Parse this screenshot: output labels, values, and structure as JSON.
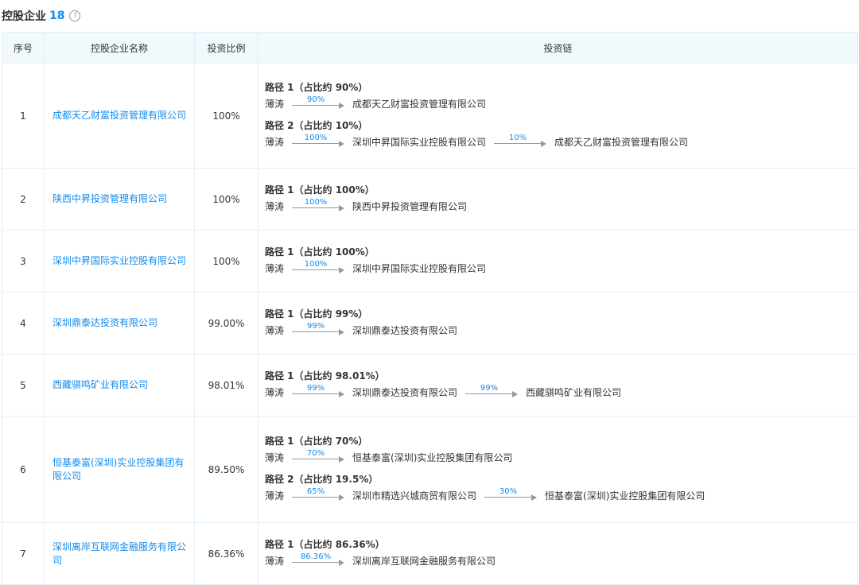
{
  "header": {
    "title": "控股企业",
    "count": "18",
    "help_icon": "question-circle-icon"
  },
  "table": {
    "columns": [
      "序号",
      "控股企业名称",
      "投资比例",
      "投资链"
    ],
    "rows": [
      {
        "index": "1",
        "name": "成都天乙财富投资管理有限公司",
        "ratio": "100%",
        "height": 132,
        "paths": [
          {
            "title": "路径 1（占比约 90%）",
            "nodes": [
              "薄涛",
              "成都天乙财富投资管理有限公司"
            ],
            "edges": [
              "90%"
            ]
          },
          {
            "title": "路径 2（占比约 10%）",
            "nodes": [
              "薄涛",
              "深圳中昇国际实业控股有限公司",
              "成都天乙财富投资管理有限公司"
            ],
            "edges": [
              "100%",
              "10%"
            ]
          }
        ]
      },
      {
        "index": "2",
        "name": "陕西中昇投资管理有限公司",
        "ratio": "100%",
        "height": 78,
        "paths": [
          {
            "title": "路径 1（占比约 100%）",
            "nodes": [
              "薄涛",
              "陕西中昇投资管理有限公司"
            ],
            "edges": [
              "100%"
            ]
          }
        ]
      },
      {
        "index": "3",
        "name": "深圳中昇国际实业控股有限公司",
        "ratio": "100%",
        "height": 78,
        "paths": [
          {
            "title": "路径 1（占比约 100%）",
            "nodes": [
              "薄涛",
              "深圳中昇国际实业控股有限公司"
            ],
            "edges": [
              "100%"
            ]
          }
        ]
      },
      {
        "index": "4",
        "name": "深圳鼎泰达投资有限公司",
        "ratio": "99.00%",
        "height": 78,
        "paths": [
          {
            "title": "路径 1（占比约 99%）",
            "nodes": [
              "薄涛",
              "深圳鼎泰达投资有限公司"
            ],
            "edges": [
              "99%"
            ]
          }
        ]
      },
      {
        "index": "5",
        "name": "西藏骐鸣矿业有限公司",
        "ratio": "98.01%",
        "height": 78,
        "paths": [
          {
            "title": "路径 1（占比约 98.01%）",
            "nodes": [
              "薄涛",
              "深圳鼎泰达投资有限公司",
              "西藏骐鸣矿业有限公司"
            ],
            "edges": [
              "99%",
              "99%"
            ]
          }
        ]
      },
      {
        "index": "6",
        "name": "恒基泰富(深圳)实业控股集团有限公司",
        "ratio": "89.50%",
        "height": 134,
        "paths": [
          {
            "title": "路径 1（占比约 70%）",
            "nodes": [
              "薄涛",
              "恒基泰富(深圳)实业控股集团有限公司"
            ],
            "edges": [
              "70%"
            ]
          },
          {
            "title": "路径 2（占比约 19.5%）",
            "nodes": [
              "薄涛",
              "深圳市精选兴城商贸有限公司",
              "恒基泰富(深圳)实业控股集团有限公司"
            ],
            "edges": [
              "65%",
              "30%"
            ]
          }
        ]
      },
      {
        "index": "7",
        "name": "深圳离岸互联网金融服务有限公司",
        "ratio": "86.36%",
        "height": 78,
        "paths": [
          {
            "title": "路径 1（占比约 86.36%）",
            "nodes": [
              "薄涛",
              "深圳离岸互联网金融服务有限公司"
            ],
            "edges": [
              "86.36%"
            ]
          }
        ]
      }
    ]
  }
}
